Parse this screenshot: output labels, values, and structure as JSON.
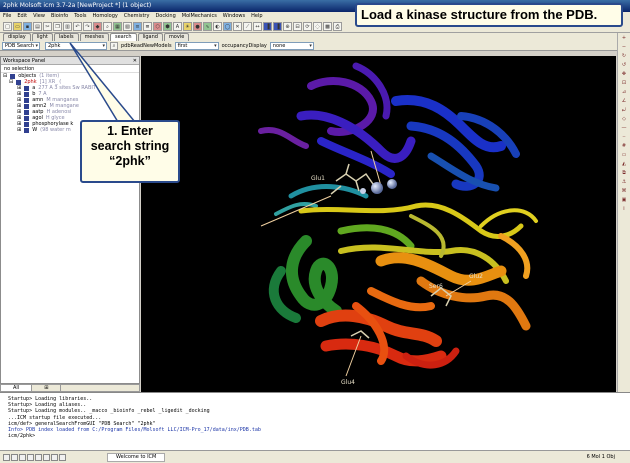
{
  "window": {
    "title": "2phk Molsoft icm 3.7-2a [NewProject *] (1 object)"
  },
  "menu": [
    "File",
    "Edit",
    "View",
    "Bioinfo",
    "Tools",
    "Homology",
    "Chemistry",
    "Docking",
    "MolMechanics",
    "Windows",
    "Help"
  ],
  "tabs": [
    {
      "label": "display",
      "active": false
    },
    {
      "label": "light",
      "active": false
    },
    {
      "label": "labels",
      "active": false
    },
    {
      "label": "meshes",
      "active": false
    },
    {
      "label": "search",
      "active": true
    },
    {
      "label": "ligand",
      "active": false
    },
    {
      "label": "movie",
      "active": false
    }
  ],
  "search": {
    "source": "PDB Search",
    "query": "2phk",
    "read_models_label": "pdbReadNewModels",
    "read_models_value": "first",
    "occupancy_label": "occupancyDisplay",
    "occupancy_value": "none"
  },
  "workspace": {
    "title": "Workspace Panel",
    "selection": "no selection",
    "objects_label": "objects",
    "objects_count": "(1 item)",
    "tree": [
      {
        "name": "2phk",
        "desc": "[1] XR_ (",
        "red": true
      },
      {
        "name": "a",
        "desc": "277 A 3 sites Sw  RABIT",
        "red": false
      },
      {
        "name": "b",
        "desc": "7 A",
        "red": false
      },
      {
        "name": "amn",
        "desc": "M  manganes",
        "red": false
      },
      {
        "name": "amn2",
        "desc": "M  mangane",
        "red": false
      },
      {
        "name": "aatp",
        "desc": "H  adenosi",
        "red": false
      },
      {
        "name": "agol",
        "desc": "H  glyce",
        "red": false
      },
      {
        "name": "phosphorylase k",
        "desc": "",
        "red": false
      },
      {
        "name": "W",
        "desc": "(98 water m",
        "red": false
      }
    ],
    "bottom_tabs": [
      {
        "label": "All",
        "active": true
      },
      {
        "label": "⊞",
        "active": false
      }
    ]
  },
  "viewer": {
    "labels": [
      "Glu1",
      "Ser6",
      "Glu2",
      "Glu4"
    ]
  },
  "terminal": {
    "lines": [
      {
        "text": "Startup> Loading libraries..",
        "blue": false
      },
      {
        "text": "Startup> Loading aliases..",
        "blue": false
      },
      {
        "text": "Startup> Loading modules.. _macco _bioinfo _rebel _ligedit _docking",
        "blue": false
      },
      {
        "text": "...ICM startup file executed...",
        "blue": false
      },
      {
        "text": "icm/def> generalSearchFromGUI \"PDB Search\" \"2phk\"",
        "blue": false
      },
      {
        "text": " Info> PDB index loaded from C:/Program Files/Molsoft LLC/ICM-Pro_17/data/inx/PDB.tab",
        "blue": true
      },
      {
        "text": "icm/2phk> ",
        "blue": false
      }
    ]
  },
  "status": {
    "message": "Welcome to ICM",
    "memory": "6 Mol 1 Obj"
  },
  "annotations": {
    "top": "Load a kinase structure from the PDB.",
    "step1": [
      "1. Enter",
      "search string",
      "“2phk”"
    ]
  },
  "colors": {
    "viewer_bg": "#000000",
    "callout_border": "#2a4a8c",
    "callout_bg": "#fffde8",
    "title_bar": "#0a246a"
  }
}
